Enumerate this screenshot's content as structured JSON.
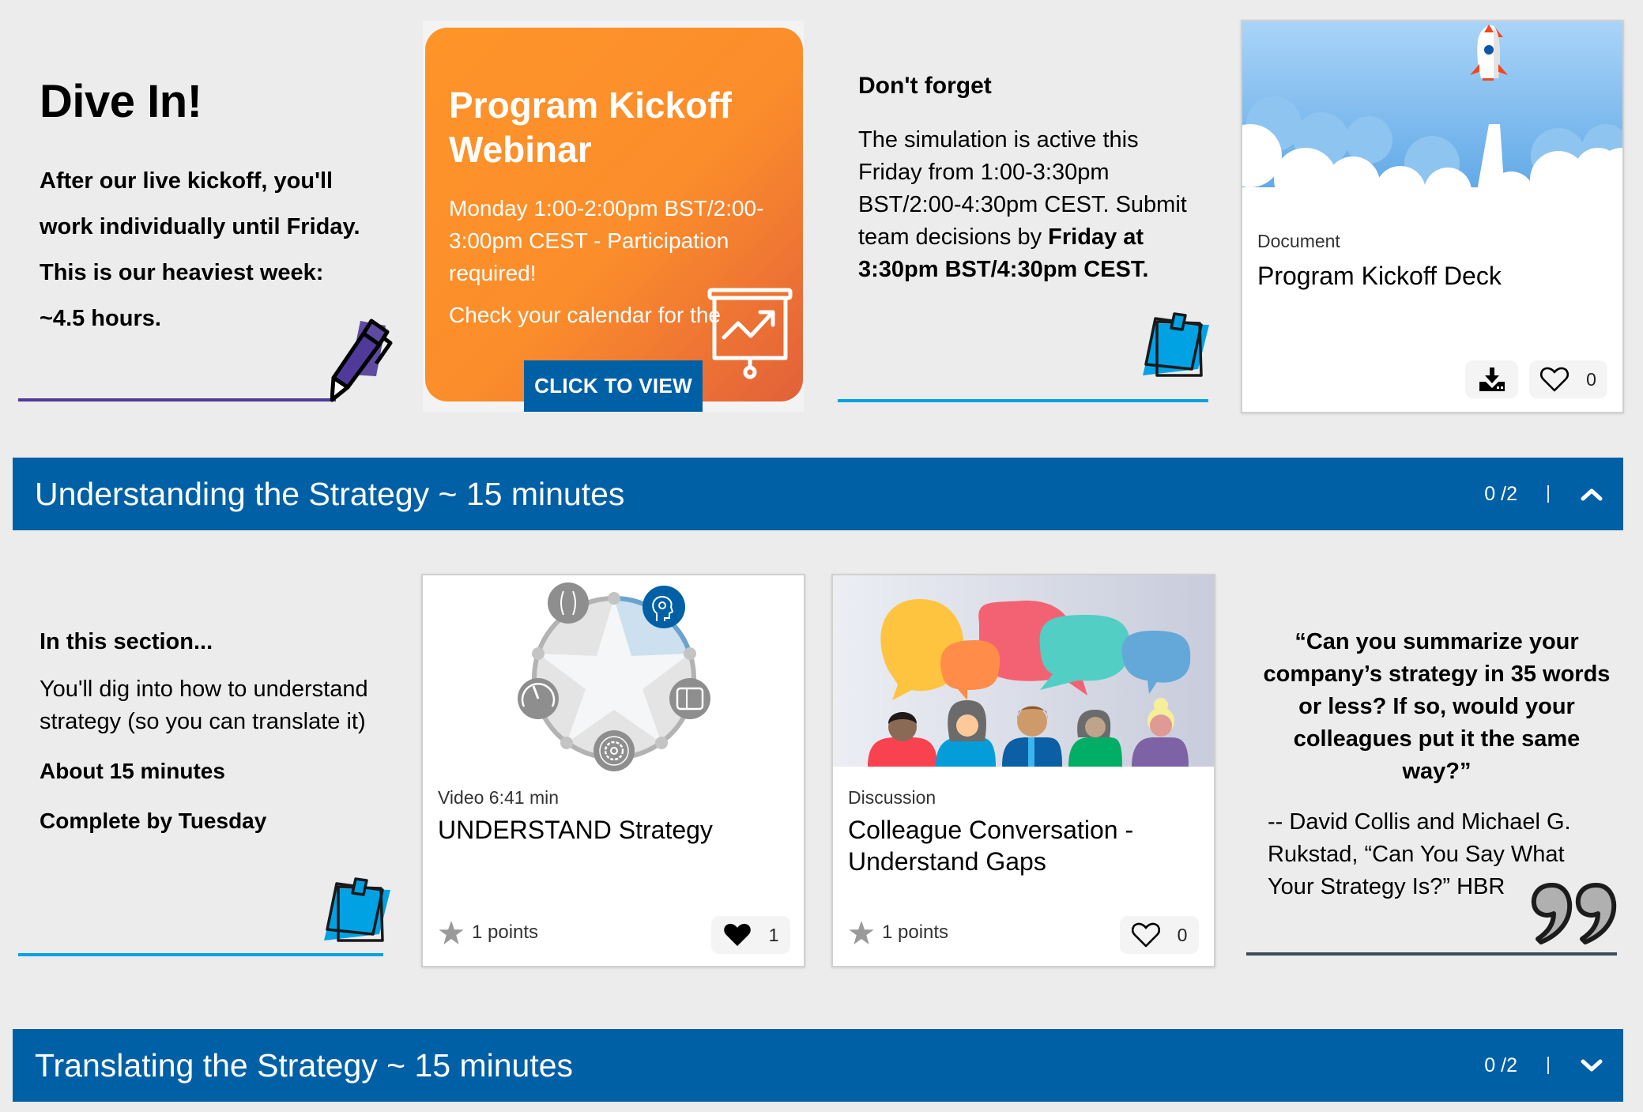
{
  "intro_card": {
    "title": "Dive In!",
    "body": "After our live kickoff, you'll work individually until Friday. This is our heaviest week:  ~4.5 hours."
  },
  "webinar_card": {
    "title": "Program Kickoff Webinar",
    "time": "Monday 1:00-2:00pm BST/2:00-3:00pm CEST - Participation required!",
    "note": "Check your calendar for the",
    "button_label": "CLICK TO VIEW"
  },
  "reminder_card": {
    "title": "Don't forget",
    "body_plain": "The simulation is active this Friday from 1:00-3:30pm BST/2:00-4:30pm CEST. Submit team decisions by ",
    "body_bold": "Friday at 3:30pm BST/4:30pm CEST."
  },
  "deck_card": {
    "type": "Document",
    "title": "Program Kickoff Deck",
    "likes": "0"
  },
  "sections": [
    {
      "title": "Understanding the Strategy ~ 15 minutes",
      "progress": "0 /2",
      "expanded": true,
      "intro": {
        "title": "In this section...",
        "body": "You'll dig into how to understand strategy (so you can translate it)",
        "duration": "About 15 minutes",
        "deadline": "Complete by Tuesday"
      },
      "items": [
        {
          "type": "Video 6:41 min",
          "title": "UNDERSTAND Strategy",
          "points": "1 points",
          "likes": "1",
          "liked": true
        },
        {
          "type": "Discussion",
          "title": "Colleague Conversation - Understand Gaps",
          "points": "1 points",
          "likes": "0",
          "liked": false
        }
      ],
      "quote": {
        "text": "“Can you summarize your company’s strategy in 35 words or less? If so, would your colleagues put it the same way?”",
        "attribution": "-- David Collis and Michael G. Rukstad, “Can You Say What Your Strategy Is?” HBR"
      }
    },
    {
      "title": "Translating the Strategy ~ 15 minutes",
      "progress": "0 /2",
      "expanded": false
    }
  ],
  "colors": {
    "brand_blue": "#0060a6",
    "orange": "#ff9429",
    "accent_purple": "#4f3a99",
    "accent_cyan": "#00a2e3",
    "background": "#ececec"
  }
}
